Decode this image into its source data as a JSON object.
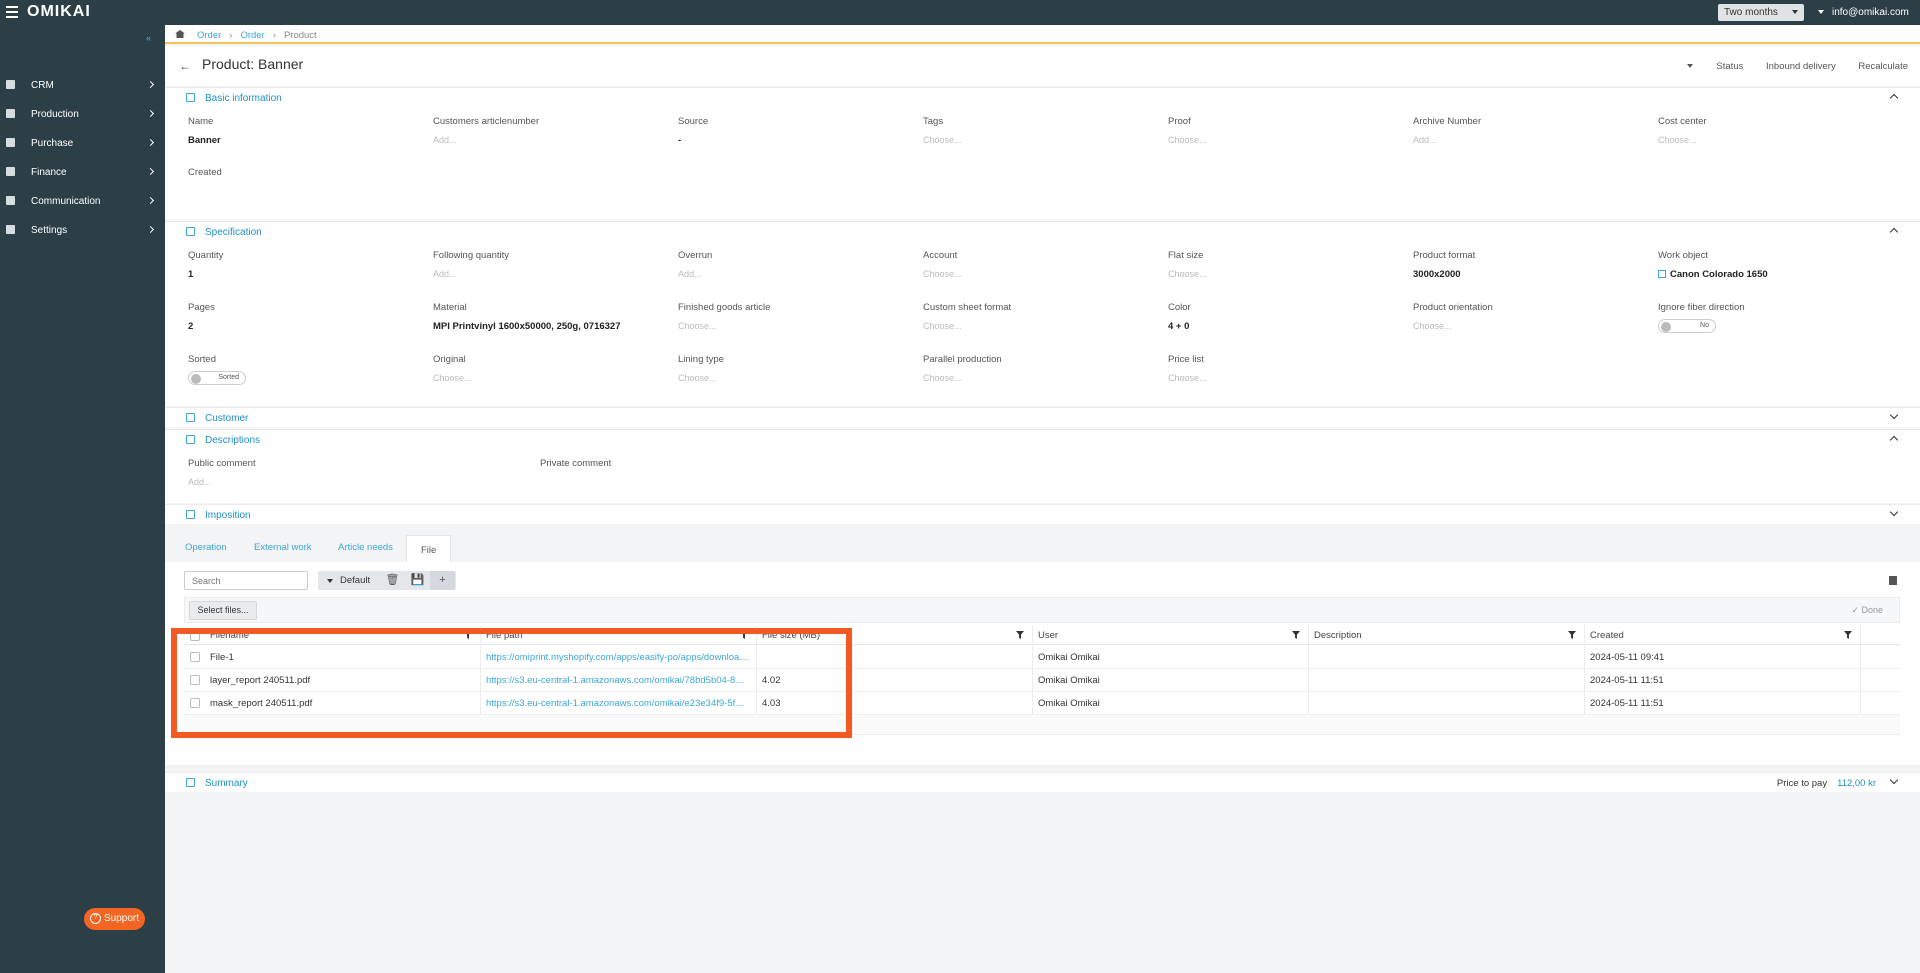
{
  "topbar": {
    "logo": "OMIKAI",
    "period": "Two months",
    "user_email": "info@omikai.com"
  },
  "sidebar": {
    "items": [
      {
        "label": "CRM",
        "icon": "contact-icon"
      },
      {
        "label": "Production",
        "icon": "gears-icon"
      },
      {
        "label": "Purchase",
        "icon": "dollar-icon"
      },
      {
        "label": "Finance",
        "icon": "invoice-icon"
      },
      {
        "label": "Communication",
        "icon": "chat-icon"
      },
      {
        "label": "Settings",
        "icon": "sliders-icon"
      }
    ],
    "support_label": "Support"
  },
  "breadcrumb": {
    "items": [
      "Order",
      "Order",
      "Product"
    ]
  },
  "header": {
    "title": "Product: Banner",
    "status_label": "Status",
    "inbound_label": "Inbound delivery",
    "recalc_label": "Recalculate"
  },
  "basic": {
    "title": "Basic information",
    "fields": [
      {
        "label": "Name",
        "value": "Banner"
      },
      {
        "label": "Customers articlenumber",
        "placeholder": "Add..."
      },
      {
        "label": "Source",
        "value": "-"
      },
      {
        "label": "Tags",
        "placeholder": "Choose..."
      },
      {
        "label": "Proof",
        "placeholder": "Choose..."
      },
      {
        "label": "Archive Number",
        "placeholder": "Add..."
      },
      {
        "label": "Cost center",
        "placeholder": "Choose..."
      },
      {
        "label": "Created"
      }
    ]
  },
  "spec": {
    "title": "Specification",
    "fields": [
      {
        "label": "Quantity",
        "value": "1"
      },
      {
        "label": "Following quantity",
        "placeholder": "Add..."
      },
      {
        "label": "Overrun",
        "placeholder": "Add..."
      },
      {
        "label": "Account",
        "placeholder": "Choose..."
      },
      {
        "label": "Flat size",
        "placeholder": "Choose..."
      },
      {
        "label": "Product format",
        "value": "3000x2000"
      },
      {
        "label": "Work object",
        "value": "Canon Colorado 1650"
      },
      {
        "label": "Pages",
        "value": "2"
      },
      {
        "label": "Material",
        "value": "MPI Printvinyl 1600x50000, 250g, 0716327"
      },
      {
        "label": "Finished goods article",
        "placeholder": "Choose..."
      },
      {
        "label": "Custom sheet format",
        "placeholder": "Choose..."
      },
      {
        "label": "Color",
        "value": "4 + 0"
      },
      {
        "label": "Product orientation",
        "placeholder": "Choose..."
      },
      {
        "label": "Ignore fiber direction",
        "toggle": "No"
      },
      {
        "label": "Sorted",
        "toggle": "Sorted"
      },
      {
        "label": "Original",
        "placeholder": "Choose..."
      },
      {
        "label": "Lining type",
        "placeholder": "Choose..."
      },
      {
        "label": "Parallel production",
        "placeholder": "Choose..."
      },
      {
        "label": "Price list",
        "placeholder": "Choose..."
      }
    ]
  },
  "customer": {
    "title": "Customer"
  },
  "descriptions": {
    "title": "Descriptions",
    "public_label": "Public comment",
    "public_placeholder": "Add...",
    "private_label": "Private comment"
  },
  "imposition": {
    "title": "Imposition"
  },
  "tabs": [
    "Operation",
    "External work",
    "Article needs",
    "File"
  ],
  "files": {
    "search_placeholder": "Search",
    "view_label": "Default",
    "select_files_label": "Select files...",
    "done_label": "Done",
    "columns": [
      "Filename",
      "File path",
      "File size (MB)",
      "User",
      "Description",
      "Created"
    ],
    "rows": [
      {
        "filename": "File-1",
        "path": "https://omiprint.myshopify.com/apps/easify-po/apps/download?...",
        "size": "",
        "user": "Omikai Omikai",
        "description": "",
        "created": "2024-05-11 09:41"
      },
      {
        "filename": "layer_report 240511.pdf",
        "path": "https://s3.eu-central-1.amazonaws.com/omikai/78bd5b04-8af0-...",
        "size": "4.02",
        "user": "Omikai Omikai",
        "description": "",
        "created": "2024-05-11 11:51"
      },
      {
        "filename": "mask_report 240511.pdf",
        "path": "https://s3.eu-central-1.amazonaws.com/omikai/e23e34f9-5f33-4...",
        "size": "4.03",
        "user": "Omikai Omikai",
        "description": "",
        "created": "2024-05-11 11:51"
      }
    ]
  },
  "summary": {
    "title": "Summary",
    "price_label": "Price to pay",
    "price_value": "112,00 kr"
  },
  "colors": {
    "accent": "#1f8fc4",
    "sidebar": "#2c3e46",
    "highlight": "#f15a22",
    "support": "#f26522"
  }
}
